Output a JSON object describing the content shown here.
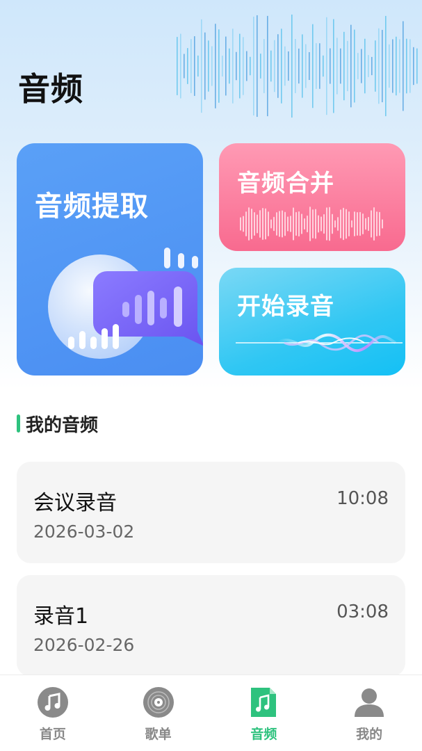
{
  "header": {
    "title": "音频"
  },
  "cards": {
    "extract": {
      "label": "音频提取"
    },
    "merge": {
      "label": "音频合并"
    },
    "record": {
      "label": "开始录音"
    }
  },
  "section": {
    "title": "我的音频"
  },
  "audio_list": [
    {
      "name": "会议录音",
      "date": "2026-03-02",
      "duration": "10:08"
    },
    {
      "name": "录音1",
      "date": "2026-02-26",
      "duration": "03:08"
    }
  ],
  "tabbar": {
    "tabs": [
      {
        "label": "首页",
        "icon": "music-note-icon",
        "active": false
      },
      {
        "label": "歌单",
        "icon": "vinyl-record-icon",
        "active": false
      },
      {
        "label": "音频",
        "icon": "audio-file-icon",
        "active": true
      },
      {
        "label": "我的",
        "icon": "user-icon",
        "active": false
      }
    ]
  },
  "colors": {
    "accent": "#2ec27e",
    "extract_card": "#4a8ef2",
    "merge_card": "#f86a8f",
    "record_card": "#31c7f3"
  }
}
